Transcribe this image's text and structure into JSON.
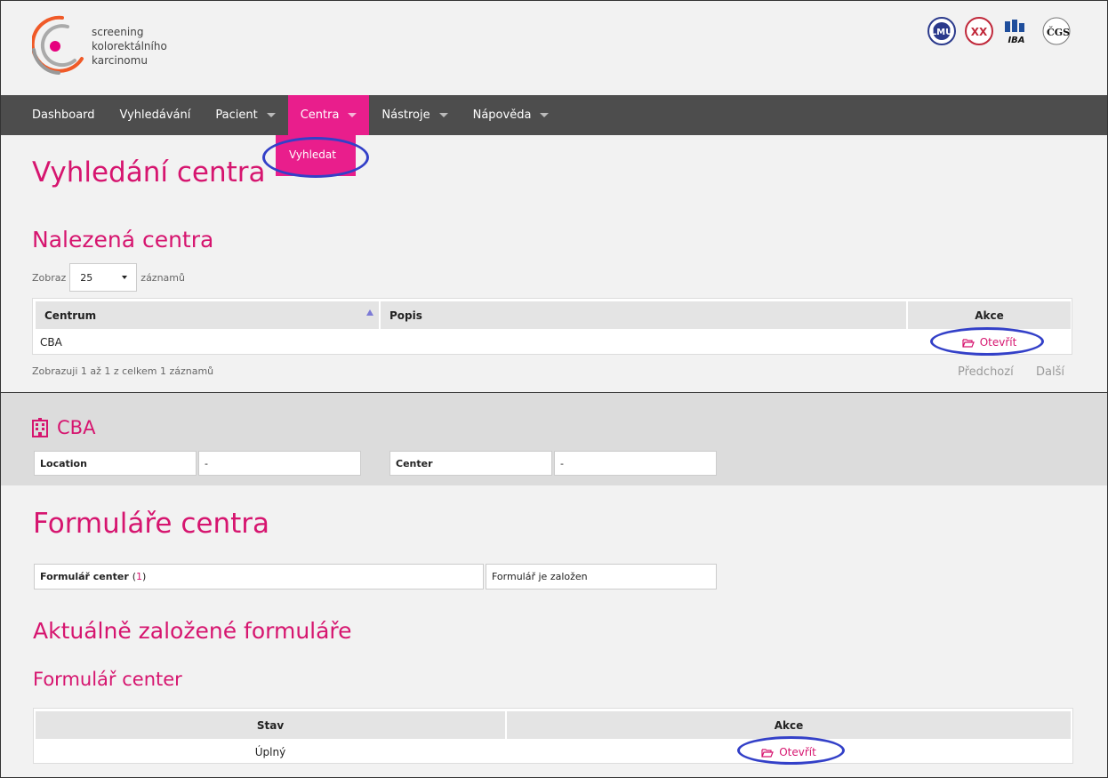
{
  "header": {
    "logo_lines": [
      "screening",
      "kolorektálního",
      "karcinomu"
    ],
    "partner_logos": [
      "LMU",
      "XX",
      "IBA",
      "ČGS"
    ]
  },
  "nav": {
    "items": [
      {
        "label": "Dashboard",
        "has_caret": false
      },
      {
        "label": "Vyhledávání",
        "has_caret": false
      },
      {
        "label": "Pacient",
        "has_caret": true
      },
      {
        "label": "Centra",
        "has_caret": true,
        "active": true
      },
      {
        "label": "Nástroje",
        "has_caret": true
      },
      {
        "label": "Nápověda",
        "has_caret": true
      }
    ],
    "dropdown": {
      "item": "Vyhledat"
    }
  },
  "search": {
    "page_title": "Vyhledání centra",
    "section_title": "Nalezená centra",
    "length_prefix": "Zobraz",
    "length_value": "25",
    "length_suffix": "záznamů",
    "columns": [
      "Centrum",
      "Popis",
      "Akce"
    ],
    "rows": [
      {
        "centrum": "CBA",
        "popis": "",
        "akce": "Otevřít"
      }
    ],
    "info": "Zobrazuji 1 až 1 z celkem 1 záznamů",
    "prev": "Předchozí",
    "next": "Další"
  },
  "center": {
    "name": "CBA",
    "fields": [
      {
        "label": "Location",
        "value": "-"
      },
      {
        "label": "Center",
        "value": "-"
      }
    ]
  },
  "forms": {
    "title": "Formuláře centra",
    "form_label": "Formulář center",
    "form_count": "1",
    "form_status": "Formulář je založen",
    "current_title": "Aktuálně založené formuláře",
    "sub_title": "Formulář center",
    "columns": [
      "Stav",
      "Akce"
    ],
    "rows": [
      {
        "stav": "Úplný",
        "akce": "Otevřít"
      }
    ]
  },
  "colors": {
    "accent": "#d6156f",
    "nav_active": "#e91e8c",
    "nav_bg": "#4d4d4d",
    "annotation": "#3340c8"
  }
}
